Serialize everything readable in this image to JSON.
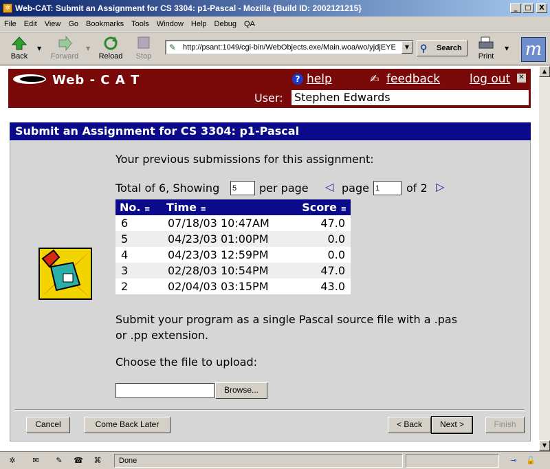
{
  "window": {
    "title": "Web-CAT: Submit an Assignment for CS 3304: p1-Pascal - Mozilla {Build ID: 2002121215}",
    "minimize": "_",
    "maximize": "□",
    "close": "X"
  },
  "menu": [
    "File",
    "Edit",
    "View",
    "Go",
    "Bookmarks",
    "Tools",
    "Window",
    "Help",
    "Debug",
    "QA"
  ],
  "toolbar": {
    "back": "Back",
    "forward": "Forward",
    "reload": "Reload",
    "stop": "Stop",
    "url": "http://psant:1049/cgi-bin/WebObjects.exe/Main.woa/wo/yjdjEYE",
    "search": "Search",
    "print": "Print"
  },
  "header": {
    "brand": "Web - C A T",
    "help": "help",
    "feedback": "feedback",
    "logout": "log out",
    "user_label": "User:",
    "user_name": "Stephen Edwards"
  },
  "panel": {
    "title": "Submit an Assignment for CS 3304: p1-Pascal",
    "previous_heading": "Your previous submissions for this assignment:",
    "total_text": "Total of 6, Showing",
    "per_page_value": "5",
    "per_page_text": "per page",
    "page_text": "page",
    "page_value": "1",
    "of_text": "of 2"
  },
  "table": {
    "headers": [
      "No.",
      "Time",
      "Score"
    ],
    "rows": [
      [
        "6",
        "07/18/03 10:47AM",
        "47.0"
      ],
      [
        "5",
        "04/23/03 01:00PM",
        "0.0"
      ],
      [
        "4",
        "04/23/03 12:59PM",
        "0.0"
      ],
      [
        "3",
        "02/28/03 10:54PM",
        "47.0"
      ],
      [
        "2",
        "02/04/03 03:15PM",
        "43.0"
      ]
    ]
  },
  "upload": {
    "instructions_line1": "Submit your program as a single Pascal source file with a .pas",
    "instructions_line2": "or .pp extension.",
    "choose_label": "Choose the file to upload:",
    "file_value": "",
    "browse": "Browse..."
  },
  "buttons": {
    "cancel": "Cancel",
    "come_back": "Come Back Later",
    "back": "< Back",
    "next": "Next >",
    "finish": "Finish"
  },
  "status": {
    "text": "Done"
  }
}
